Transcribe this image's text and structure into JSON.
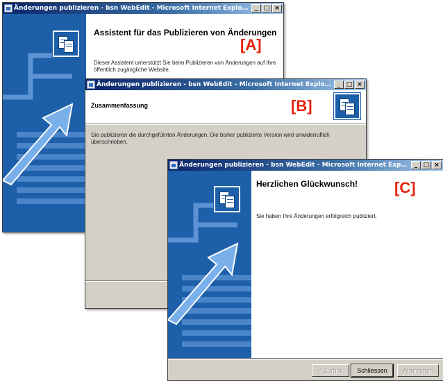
{
  "window_a": {
    "title": "Änderungen publizieren - bsn WebEdit - Microsoft Internet Explorer  zur Verfügung ge...",
    "heading": "Assistent für das Publizieren von Änderungen",
    "body": "Dieser Assistent unterstützt Sie beim Publizieren von Änderungen auf Ihre öffentlich zugängliche Website.",
    "marker": "[A]"
  },
  "window_b": {
    "title": "Änderungen publizieren - bsn WebEdit - Microsoft Internet Explorer  zur Verfügung ge...",
    "heading": "Zusammenfassung",
    "body": "Sie publizieren die durchgeführten Änderungen. Die bisher publizierte Version wird unwiderruflich überschrieben.",
    "marker": "[B]"
  },
  "window_c": {
    "title": "Änderungen publizieren - bsn WebEdit - Microsoft Internet Explorer  zur Verfügung ge...",
    "heading": "Herzlichen Glückwunsch!",
    "body": "Sie haben Ihre Änderungen erfolgreich publiziert.",
    "marker": "[C]",
    "buttons": {
      "back": "< Zurück",
      "close": "Schliessen",
      "cancel": "Abbrechen"
    }
  },
  "titlebar_buttons": {
    "minimize": "_",
    "maximize": "□",
    "close": "×"
  },
  "colors": {
    "side_panel": "#1d5fa8",
    "marker": "#e8220a",
    "titlebar_start": "#0a246a",
    "dialog_face": "#d4d0c8"
  },
  "icons": [
    "ie-page-icon",
    "publish-pages-icon",
    "arrow-artwork-icon"
  ]
}
